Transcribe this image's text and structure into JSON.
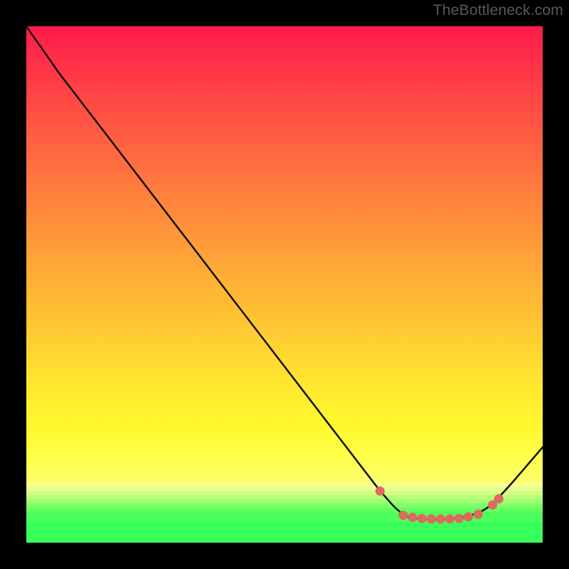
{
  "watermark": "TheBottleneck.com",
  "chart_data": {
    "type": "line",
    "title": "",
    "xlabel": "",
    "ylabel": "",
    "xlim": [
      0,
      100
    ],
    "ylim": [
      0,
      100
    ],
    "grid": false,
    "series": [
      {
        "name": "curve",
        "stroke": "#111111",
        "stroke_width": 2.5,
        "points": [
          {
            "x": 0,
            "y": 100.0
          },
          {
            "x": 6.3,
            "y": 91.0
          },
          {
            "x": 67.0,
            "y": 12.0
          },
          {
            "x": 68.5,
            "y": 10.0
          },
          {
            "x": 73.0,
            "y": 5.0
          },
          {
            "x": 77.0,
            "y": 4.5
          },
          {
            "x": 82.0,
            "y": 4.5
          },
          {
            "x": 87.5,
            "y": 5.5
          },
          {
            "x": 91.0,
            "y": 8.0
          },
          {
            "x": 100.0,
            "y": 18.5
          }
        ]
      }
    ],
    "markers": {
      "name": "dots",
      "fill": "#e0685c",
      "radius": 6.5,
      "points": [
        {
          "x": 68.5,
          "y": 10.0
        },
        {
          "x": 73.0,
          "y": 5.3
        },
        {
          "x": 74.8,
          "y": 4.9
        },
        {
          "x": 76.6,
          "y": 4.7
        },
        {
          "x": 78.4,
          "y": 4.6
        },
        {
          "x": 80.2,
          "y": 4.6
        },
        {
          "x": 82.0,
          "y": 4.6
        },
        {
          "x": 83.8,
          "y": 4.7
        },
        {
          "x": 85.6,
          "y": 5.0
        },
        {
          "x": 87.5,
          "y": 5.5
        },
        {
          "x": 90.3,
          "y": 7.3
        },
        {
          "x": 91.5,
          "y": 8.5
        }
      ]
    }
  }
}
